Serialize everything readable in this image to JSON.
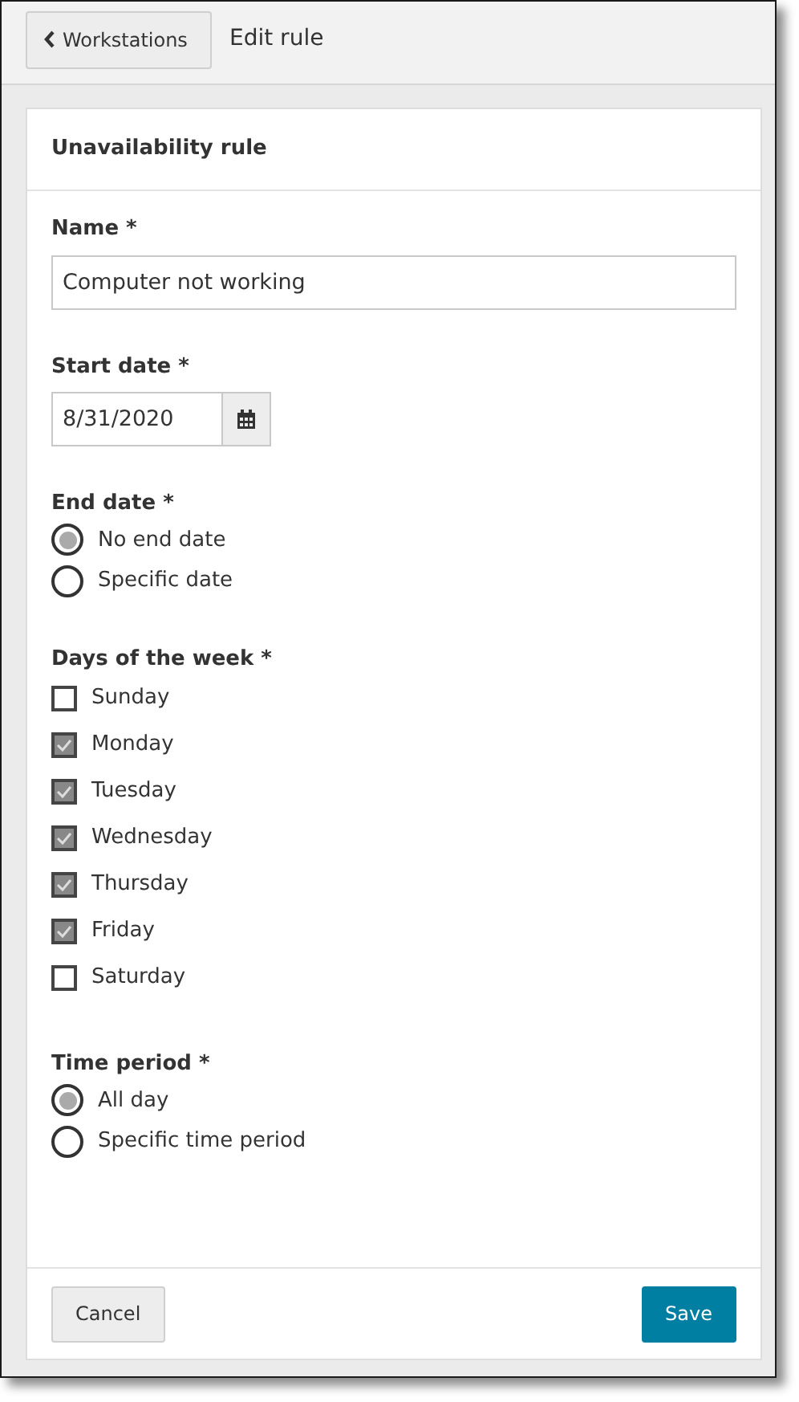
{
  "header": {
    "back_button": {
      "label": "Workstations"
    },
    "title": "Edit rule"
  },
  "card": {
    "title": "Unavailability rule",
    "name_field": {
      "label": "Name *",
      "value": "Computer not working"
    },
    "start_date": {
      "label": "Start date *",
      "value": "8/31/2020"
    },
    "end_date": {
      "label": "End date *",
      "options": [
        {
          "label": "No end date",
          "selected": true
        },
        {
          "label": "Specific date",
          "selected": false
        }
      ]
    },
    "days": {
      "label": "Days of the week *",
      "items": [
        {
          "label": "Sunday",
          "checked": false
        },
        {
          "label": "Monday",
          "checked": true
        },
        {
          "label": "Tuesday",
          "checked": true
        },
        {
          "label": "Wednesday",
          "checked": true
        },
        {
          "label": "Thursday",
          "checked": true
        },
        {
          "label": "Friday",
          "checked": true
        },
        {
          "label": "Saturday",
          "checked": false
        }
      ]
    },
    "time_period": {
      "label": "Time period *",
      "options": [
        {
          "label": "All day",
          "selected": true
        },
        {
          "label": "Specific time period",
          "selected": false
        }
      ]
    },
    "buttons": [
      {
        "label": "Cancel",
        "kind": "secondary"
      },
      {
        "label": "Save",
        "kind": "primary"
      }
    ]
  }
}
